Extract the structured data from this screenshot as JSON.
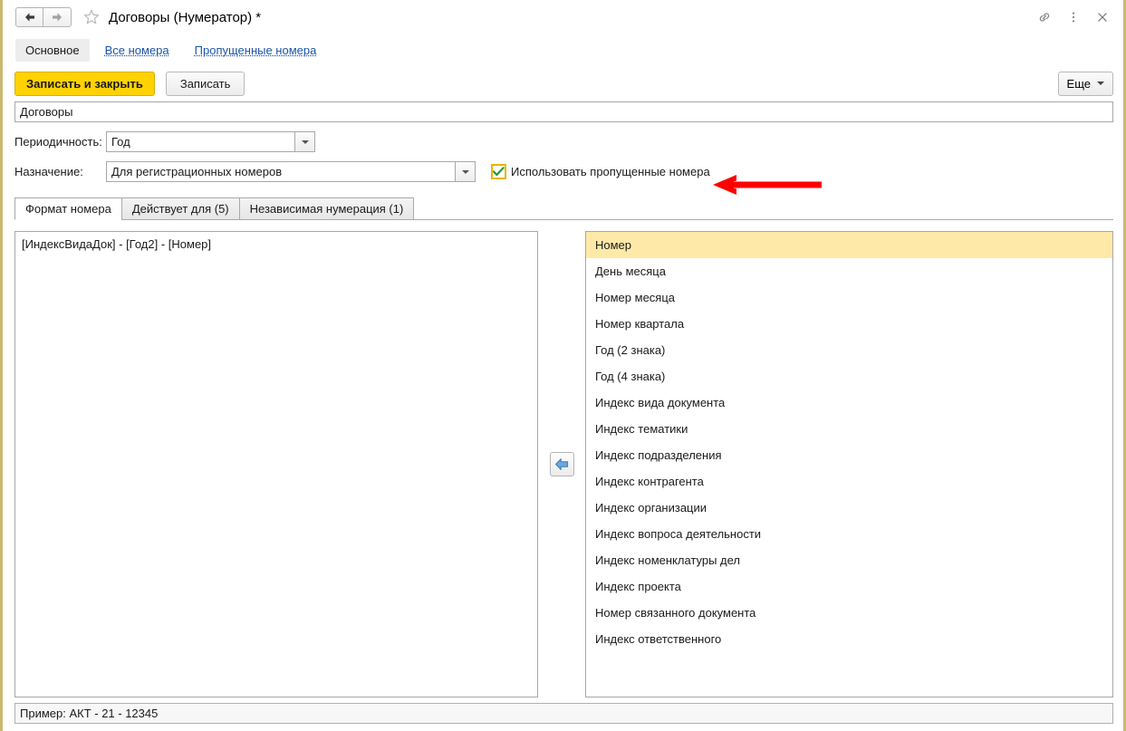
{
  "window": {
    "title": "Договоры (Нумератор) *",
    "nav_back_icon": "arrow-left-icon",
    "nav_forward_icon": "arrow-right-icon",
    "favorite_icon": "star-icon",
    "link_icon": "link-icon",
    "menu_icon": "kebab-menu-icon",
    "close_icon": "close-icon",
    "accent_color": "#c9b971"
  },
  "nav_links": [
    {
      "label": "Основное",
      "active": true
    },
    {
      "label": "Все номера",
      "active": false
    },
    {
      "label": "Пропущенные номера",
      "active": false
    }
  ],
  "commandbar": {
    "save_and_close_label": "Записать и закрыть",
    "save_label": "Записать",
    "more_label": "Еще",
    "more_icon": "chevron-down-icon",
    "primary_color": "#ffd200"
  },
  "form": {
    "name_value": "Договоры",
    "name_placeholder": "",
    "periodicity_label": "Периодичность:",
    "periodicity_value": "Год",
    "periodicity_dropdown_icon": "chevron-down-icon",
    "purpose_label": "Назначение:",
    "purpose_value": "Для регистрационных номеров",
    "purpose_dropdown_icon": "chevron-down-icon",
    "use_skipped_label": "Использовать пропущенные номера",
    "use_skipped_checked": true,
    "checkbox_focus_color": "#e8b500",
    "check_color": "#1a9a2e"
  },
  "annotation": {
    "arrow_icon": "arrow-left-annotation",
    "color": "#ff0000"
  },
  "tabs": [
    {
      "label": "Формат номера",
      "active": true
    },
    {
      "label": "Действует для (5)",
      "active": false
    },
    {
      "label": "Независимая нумерация (1)",
      "active": false
    }
  ],
  "format_editor": {
    "value": "[ИндексВидаДок] - [Год2] - [Номер]"
  },
  "move_button": {
    "icon": "arrow-left-blue-icon"
  },
  "available_fields": {
    "selected_index": 0,
    "highlight_color": "#ffe9a8",
    "items": [
      "Номер",
      "День месяца",
      "Номер месяца",
      "Номер квартала",
      "Год (2 знака)",
      "Год (4 знака)",
      "Индекс вида документа",
      "Индекс тематики",
      "Индекс подразделения",
      "Индекс контрагента",
      "Индекс организации",
      "Индекс вопроса деятельности",
      "Индекс номенклатуры дел",
      "Индекс проекта",
      "Номер связанного документа",
      "Индекс ответственного"
    ]
  },
  "statusbar": {
    "example_text": "Пример: АКТ - 21 - 12345"
  }
}
